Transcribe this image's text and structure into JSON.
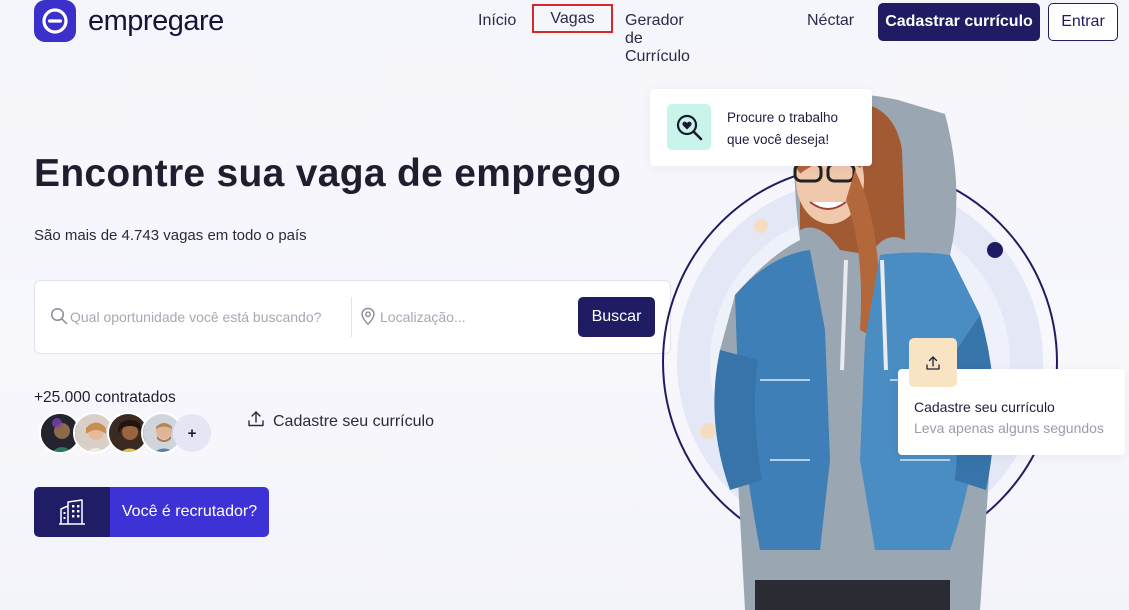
{
  "brand": {
    "name": "empregare",
    "accent": "#3b30c9",
    "dark": "#1f1c63"
  },
  "nav": {
    "items": [
      "Início",
      "Vagas",
      "Gerador de Currículo",
      "Néctar"
    ],
    "cta_primary": "Cadastrar currículo",
    "cta_secondary": "Entrar"
  },
  "hero": {
    "title": "Encontre sua vaga de emprego",
    "subtitle": "São mais de 4.743 vagas em todo o país"
  },
  "search": {
    "query_placeholder": "Qual oportunidade você está buscando?",
    "location_placeholder": "Localização...",
    "button": "Buscar"
  },
  "social_proof": {
    "hired_text": "+25.000 contratados",
    "more_symbol": "+"
  },
  "upload_link": "Cadastre seu currículo",
  "recruiter_button": "Você é recrutador?",
  "illustration": {
    "card_top": {
      "line1": "Procure o trabalho",
      "line2": "que você deseja!",
      "icon": "search-heart-icon"
    },
    "card_bottom": {
      "title": "Cadastre seu currículo",
      "subtitle": "Leva apenas alguns segundos",
      "icon": "upload-icon"
    }
  }
}
